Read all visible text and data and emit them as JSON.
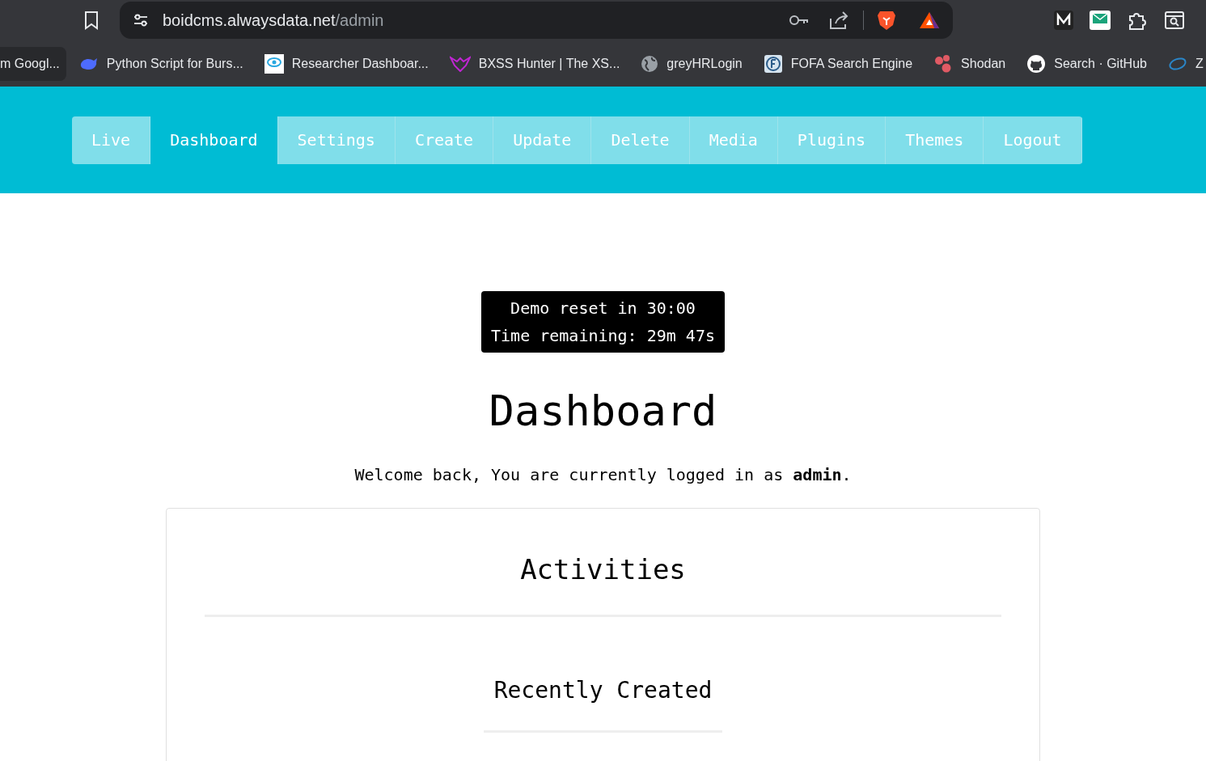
{
  "browser": {
    "url_host": "boidcms.alwaysdata.net",
    "url_path": "/admin"
  },
  "bookmarks": [
    {
      "label": "m Googl..."
    },
    {
      "label": "Python Script for Burs..."
    },
    {
      "label": "Researcher Dashboar..."
    },
    {
      "label": "BXSS Hunter | The XS..."
    },
    {
      "label": "greyHRLogin"
    },
    {
      "label": "FOFA Search Engine"
    },
    {
      "label": "Shodan"
    },
    {
      "label": "Search · GitHub"
    },
    {
      "label": "Z"
    }
  ],
  "nav": [
    {
      "label": "Live",
      "selected": false
    },
    {
      "label": "Dashboard",
      "selected": true
    },
    {
      "label": "Settings",
      "selected": false
    },
    {
      "label": "Create",
      "selected": false
    },
    {
      "label": "Update",
      "selected": false
    },
    {
      "label": "Delete",
      "selected": false
    },
    {
      "label": "Media",
      "selected": false
    },
    {
      "label": "Plugins",
      "selected": false
    },
    {
      "label": "Themes",
      "selected": false
    },
    {
      "label": "Logout",
      "selected": false
    }
  ],
  "demo_notice": [
    "Demo reset in 30:00",
    "Time remaining: 29m 47s"
  ],
  "title": "Dashboard",
  "welcome": "Welcome back, You are currently logged in as **admin**.",
  "activities": {
    "title": "Activities",
    "section_title": "Recently Created"
  }
}
